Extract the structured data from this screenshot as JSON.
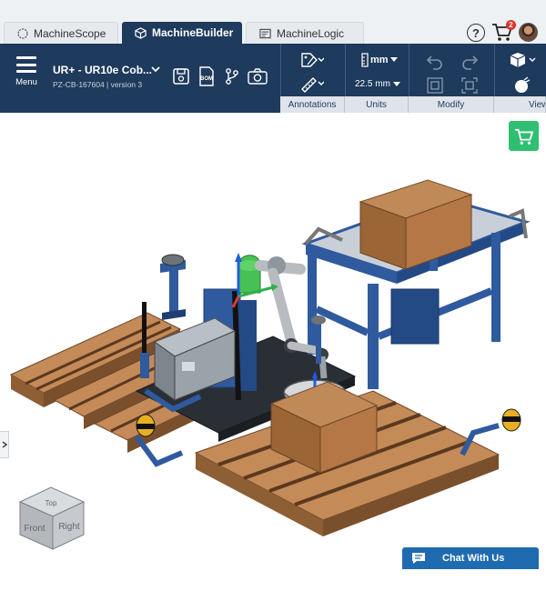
{
  "tabs": [
    {
      "label": "MachineScope",
      "icon": "scope-icon",
      "active": false
    },
    {
      "label": "MachineBuilder",
      "icon": "cube-icon",
      "active": true
    },
    {
      "label": "MachineLogic",
      "icon": "logic-icon",
      "active": false
    }
  ],
  "header": {
    "help_label": "?",
    "cart_count": "2",
    "avatar": "user-avatar"
  },
  "toolbar": {
    "menu_label": "Menu",
    "project_name": "UR+ - UR10e Cob...",
    "project_sub": "PZ-CB-167604 | version 3",
    "icons": [
      "save-icon",
      "bom-icon",
      "branch-icon",
      "camera-icon"
    ],
    "bom_text": "BOM",
    "groups": [
      {
        "label": "Annotations"
      },
      {
        "label": "Units"
      },
      {
        "label": "Modify"
      },
      {
        "label": "View"
      }
    ],
    "units_value": "mm",
    "scale_value": "22.5 mm"
  },
  "viewport": {
    "cube_faces": {
      "top": "Top",
      "front": "Front",
      "right": "Right"
    },
    "chat_label": "Chat With Us"
  },
  "colors": {
    "toolbar_bg": "#1e3a5c",
    "cart_green": "#2fbf71",
    "chat_blue": "#1f6bb0",
    "frame_blue": "#2f5a9e",
    "pallet_wood": "#b07a4f",
    "box_brown": "#a8703f"
  }
}
